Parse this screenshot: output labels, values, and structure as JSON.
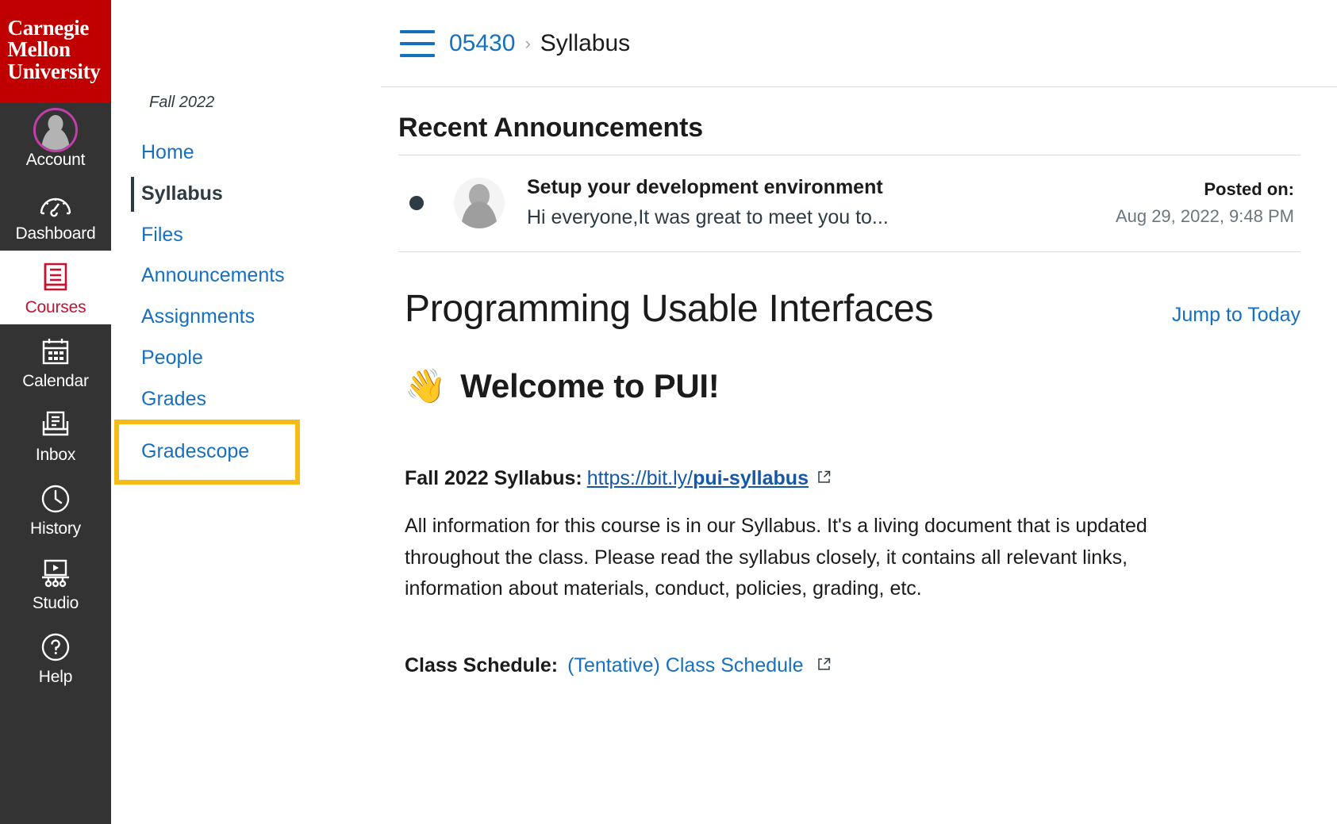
{
  "brand": {
    "name": "Carnegie\nMellon\nUniversity",
    "bg_color": "#C00000"
  },
  "global_nav": {
    "items": [
      {
        "label": "Account",
        "icon": "user-avatar-icon"
      },
      {
        "label": "Dashboard",
        "icon": "dashboard-gauge-icon"
      },
      {
        "label": "Courses",
        "icon": "courses-book-icon",
        "active": true
      },
      {
        "label": "Calendar",
        "icon": "calendar-icon"
      },
      {
        "label": "Inbox",
        "icon": "inbox-tray-icon"
      },
      {
        "label": "History",
        "icon": "clock-icon"
      },
      {
        "label": "Studio",
        "icon": "studio-video-icon"
      },
      {
        "label": "Help",
        "icon": "question-mark-icon"
      }
    ],
    "active_color": "#C41230",
    "avatar_ring_color": "#BF3FA8"
  },
  "course_nav": {
    "term": "Fall 2022",
    "items": [
      {
        "label": "Home",
        "state": "normal"
      },
      {
        "label": "Syllabus",
        "state": "current"
      },
      {
        "label": "Files",
        "state": "normal"
      },
      {
        "label": "Announcements",
        "state": "normal"
      },
      {
        "label": "Assignments",
        "state": "normal"
      },
      {
        "label": "People",
        "state": "normal"
      },
      {
        "label": "Grades",
        "state": "normal"
      },
      {
        "label": "Gradescope",
        "state": "highlighted"
      }
    ],
    "highlight_color": "#F5BC18"
  },
  "topbar": {
    "menu_icon": "hamburger-menu-icon",
    "breadcrumb_course": "05430",
    "breadcrumb_separator": "›",
    "breadcrumb_current": "Syllabus"
  },
  "announcements": {
    "heading": "Recent Announcements",
    "items": [
      {
        "title": "Setup your development environment",
        "snippet": "Hi everyone,It was great to meet you to...",
        "posted_label": "Posted on:",
        "posted_date": "Aug 29, 2022, 9:48 PM"
      }
    ]
  },
  "syllabus": {
    "course_title": "Programming Usable Interfaces",
    "jump_link": "Jump to Today",
    "welcome_emoji": "👋",
    "welcome_heading": "Welcome to PUI!",
    "syllabus_label": "Fall 2022 Syllabus:",
    "syllabus_link_prefix": "https://bit.ly/",
    "syllabus_link_bold": "pui-syllabus",
    "paragraph": "All information for this course is in our Syllabus. It's a living document that is updated throughout the class. Please read the syllabus closely, it contains all relevant links, information about materials, conduct, policies, grading, etc.",
    "schedule_label": "Class Schedule:",
    "schedule_link": "(Tentative) Class Schedule"
  }
}
